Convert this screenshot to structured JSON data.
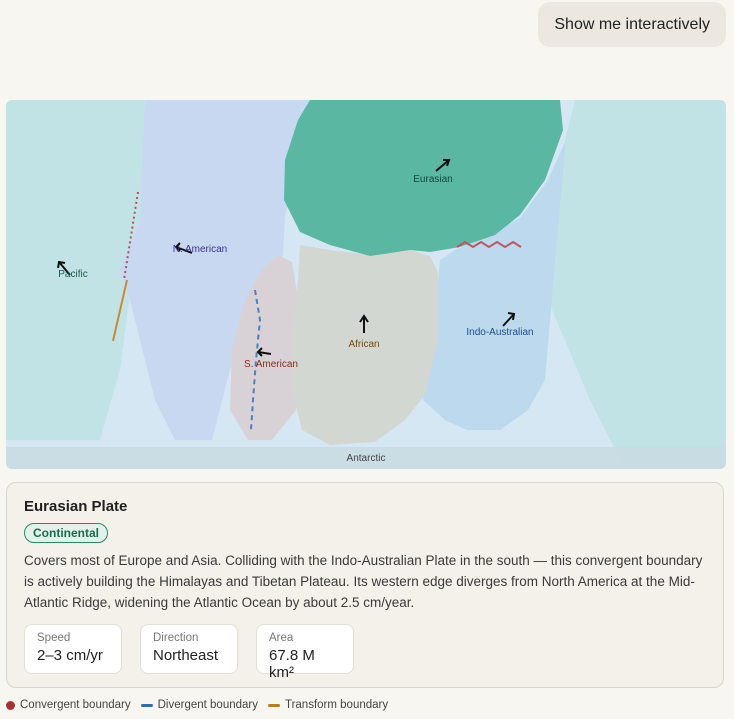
{
  "chat": {
    "user_message": "Show me interactively"
  },
  "map": {
    "plates": [
      {
        "name": "Pacific",
        "color": "#c2e3e6",
        "label_color": "#1c5a4a"
      },
      {
        "name": "N. American",
        "color": "#c8d8f0",
        "label_color": "#3b3190"
      },
      {
        "name": "Eurasian",
        "color": "#5ab7a1",
        "label_color": "#0f4a3c"
      },
      {
        "name": "African",
        "color": "#d3d7d2",
        "label_color": "#7a4a0a"
      },
      {
        "name": "S. American",
        "color": "#d8d1d6",
        "label_color": "#8a2e1a"
      },
      {
        "name": "Indo-Australian",
        "color": "#bcd9ee",
        "label_color": "#1b4f8f"
      },
      {
        "name": "Antarctic",
        "color": "#c9dae2",
        "label_color": "#444444"
      }
    ],
    "ocean_color": "#d6e7f4"
  },
  "detail": {
    "title": "Eurasian Plate",
    "badge": "Continental",
    "description": "Covers most of Europe and Asia. Colliding with the Indo-Australian Plate in the south — this convergent boundary is actively building the Himalayas and Tibetan Plateau. Its western edge diverges from North America at the Mid-Atlantic Ridge, widening the Atlantic Ocean by about 2.5 cm/year.",
    "stats": [
      {
        "label": "Speed",
        "value": "2–3 cm/yr"
      },
      {
        "label": "Direction",
        "value": "Northeast"
      },
      {
        "label": "Area",
        "value": "67.8 M km²"
      }
    ]
  },
  "legend": [
    {
      "label": "Convergent boundary",
      "color": "#a83232"
    },
    {
      "label": "Divergent boundary",
      "color": "#2a6fb5"
    },
    {
      "label": "Transform boundary",
      "color": "#c07a1a"
    }
  ]
}
